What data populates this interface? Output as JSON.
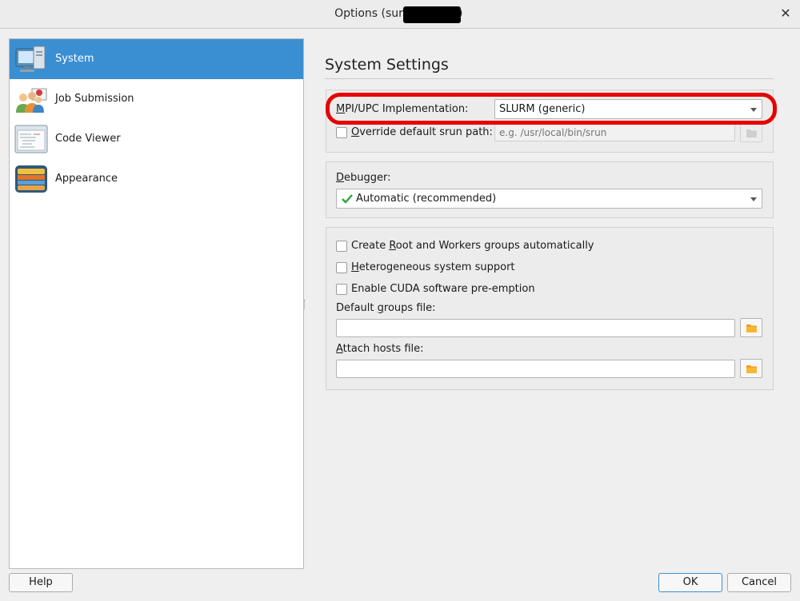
{
  "window": {
    "title": "Options (sur",
    "title_suffix": ")"
  },
  "sidebar": {
    "items": [
      {
        "label": "System",
        "icon": "system-monitor-icon",
        "selected": true
      },
      {
        "label": "Job Submission",
        "icon": "users-icon",
        "selected": false
      },
      {
        "label": "Code Viewer",
        "icon": "code-window-icon",
        "selected": false
      },
      {
        "label": "Appearance",
        "icon": "appearance-palette-icon",
        "selected": false
      }
    ]
  },
  "main": {
    "title": "System Settings",
    "mpi": {
      "label_accel": "M",
      "label_rest": "PI/UPC Implementation:",
      "value": "SLURM (generic)"
    },
    "override": {
      "label_accel": "O",
      "label_rest": "verride default srun path:",
      "checked": false,
      "placeholder": "e.g. /usr/local/bin/srun"
    },
    "debugger": {
      "label_accel": "D",
      "label_rest": "ebugger:",
      "value": "Automatic (recommended)",
      "icon": "check-icon"
    },
    "options": {
      "create_groups": {
        "pre": "Create ",
        "accel": "R",
        "post": "oot and Workers groups automatically",
        "checked": false
      },
      "heterogeneous": {
        "pre": "",
        "accel": "H",
        "post": "eterogeneous system support",
        "checked": false
      },
      "cuda": {
        "pre": "Enable CUDA software pre-emption",
        "accel": "",
        "post": "",
        "checked": false
      }
    },
    "groups_file": {
      "pre": "Default ",
      "accel": "g",
      "post": "roups file:",
      "value": ""
    },
    "hosts_file": {
      "pre": "",
      "accel": "A",
      "post": "ttach hosts file:",
      "value": ""
    }
  },
  "footer": {
    "help": "Help",
    "ok": "OK",
    "cancel": "Cancel"
  },
  "colors": {
    "accent": "#3a8fd3",
    "highlight": "#e80000",
    "check": "#2fa334"
  }
}
